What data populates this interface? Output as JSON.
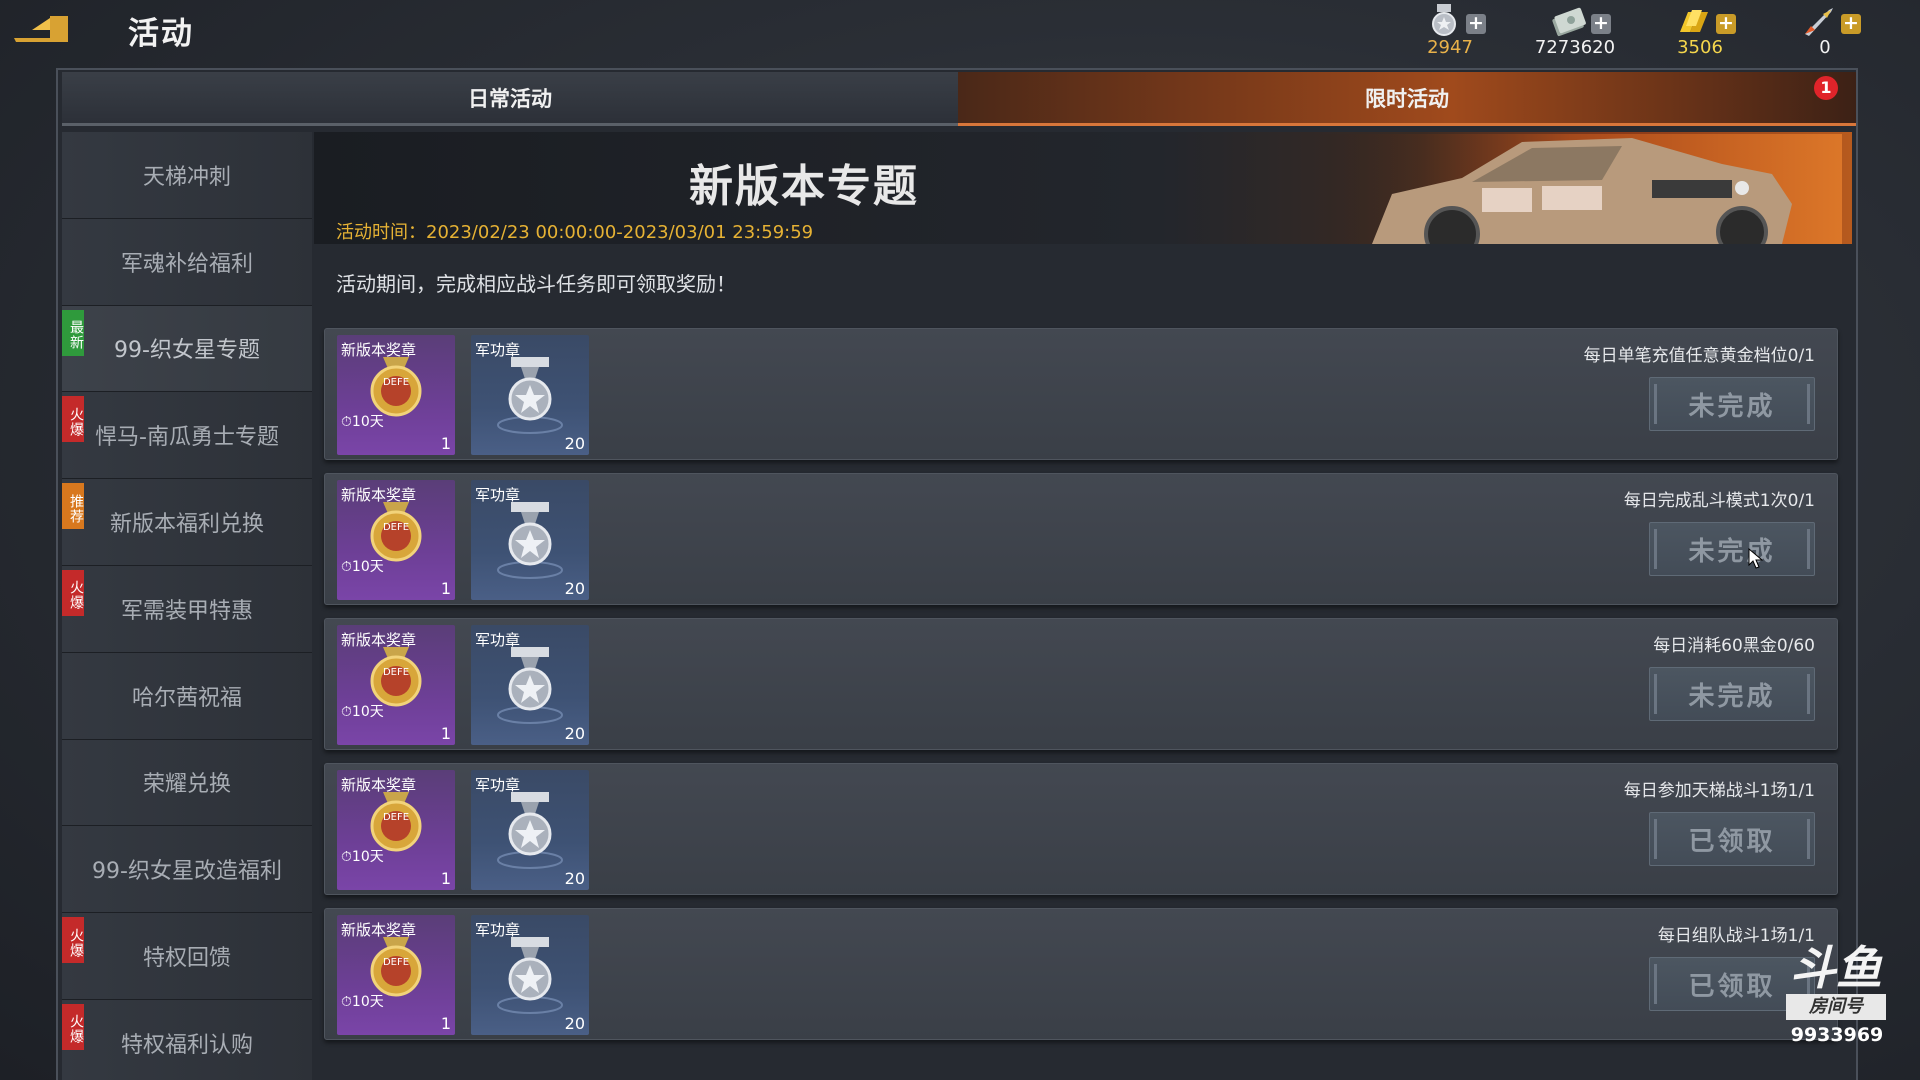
{
  "header": {
    "title": "活动",
    "back_icon": "back-arrow-icon"
  },
  "currencies": [
    {
      "icon": "medal-icon",
      "value": "2947",
      "color": "#e9b24a"
    },
    {
      "icon": "cash-icon",
      "value": "7273620",
      "color": "#f2f2f2"
    },
    {
      "icon": "gold-bar-icon",
      "value": "3506",
      "color": "#f5d64c"
    },
    {
      "icon": "rocket-icon",
      "value": "0",
      "color": "#f2f2f2"
    }
  ],
  "tabs": {
    "daily": "日常活动",
    "limited": "限时活动",
    "limited_badge": "1"
  },
  "sidebar": {
    "items": [
      {
        "label": "天梯冲刺",
        "tag": ""
      },
      {
        "label": "军魂补给福利",
        "tag": ""
      },
      {
        "label": "99-织女星专题",
        "tag": "最新"
      },
      {
        "label": "悍马-南瓜勇士专题",
        "tag": "火爆"
      },
      {
        "label": "新版本福利兑换",
        "tag": "推荐"
      },
      {
        "label": "军需装甲特惠",
        "tag": "火爆"
      },
      {
        "label": "哈尔茜祝福",
        "tag": ""
      },
      {
        "label": "荣耀兑换",
        "tag": ""
      },
      {
        "label": "99-织女星改造福利",
        "tag": ""
      },
      {
        "label": "特权回馈",
        "tag": "火爆"
      },
      {
        "label": "特权福利认购",
        "tag": "火爆"
      }
    ]
  },
  "banner": {
    "title": "新版本专题",
    "time": "活动时间：2023/02/23 00:00:00-2023/03/01 23:59:59"
  },
  "description": "活动期间，完成相应战斗任务即可领取奖励！",
  "rewards": {
    "r1_name": "新版本奖章",
    "r1_timer": "10天",
    "r1_count": "1",
    "r2_name": "军功章",
    "r2_count": "20"
  },
  "tasks": [
    {
      "requirement": "每日单笔充值任意黄金档位0/1",
      "button": "未完成"
    },
    {
      "requirement": "每日完成乱斗模式1次0/1",
      "button": "未完成"
    },
    {
      "requirement": "每日消耗60黑金0/60",
      "button": "未完成"
    },
    {
      "requirement": "每日参加天梯战斗1场1/1",
      "button": "已领取"
    },
    {
      "requirement": "每日组队战斗1场1/1",
      "button": "已领取"
    }
  ],
  "watermark": {
    "logo": "斗鱼",
    "sub": "房间号",
    "room": "9933969"
  }
}
